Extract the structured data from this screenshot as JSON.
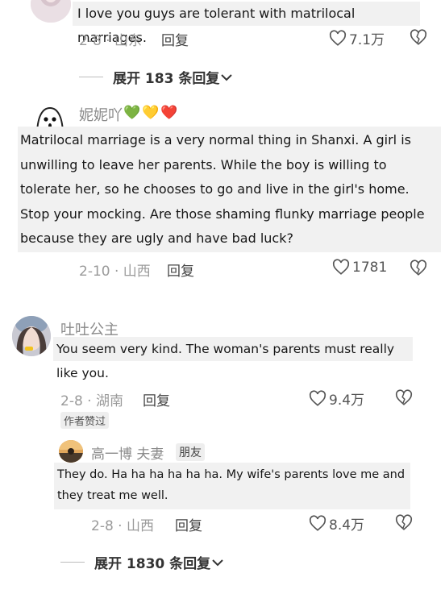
{
  "comments": [
    {
      "username": "",
      "text": "I love you guys are tolerant with matrilocal marriages.",
      "time_location": "2-8 · 山东",
      "reply_label": "回复",
      "likes": "7.1万"
    },
    {
      "username": "妮妮吖",
      "username_emojis": [
        "💚",
        "💛",
        "❤️"
      ],
      "text": "Matrilocal marriage is a very normal thing in Shanxi. A girl is unwilling to leave her parents. While the boy is willing to tolerate her, so he chooses to go and live in the girl's home. Stop your mocking. Are those shaming flunky marriage people because they are ugly and have bad luck?",
      "time_location": "2-10 · 山西",
      "reply_label": "回复",
      "likes": "1781"
    },
    {
      "username": "吐吐公主",
      "text": "You seem very kind. The woman's parents must really like you.",
      "time_location": "2-8 · 湖南",
      "reply_label": "回复",
      "likes": "9.4万",
      "author_badge": "作者赞过"
    }
  ],
  "nested_reply": {
    "username": "高一博 夫妻",
    "relation_badge": "朋友",
    "text": "They do. Ha ha ha ha ha ha. My wife's parents love me and they treat me well.",
    "time_location": "2-8 · 山西",
    "reply_label": "回复",
    "likes": "8.4万"
  },
  "expanders": [
    {
      "label": "展开 183 条回复"
    },
    {
      "label": "展开 1830 条回复"
    }
  ],
  "colors": {
    "background": "#ffffff",
    "text_box": "#f1f1f1",
    "muted": "#9a9a9a"
  }
}
